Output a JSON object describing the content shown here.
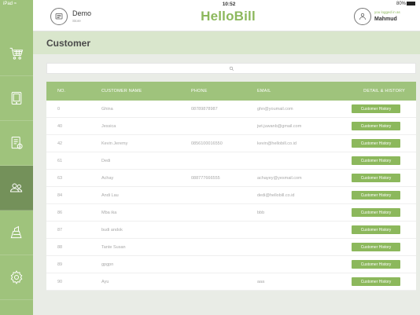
{
  "status_bar": {
    "device": "iPad",
    "time": "10:52",
    "battery": "80%"
  },
  "header": {
    "store_name": "Demo",
    "store_sub": "Store",
    "brand": "HelloBill",
    "logged_in_label": "you logged in as",
    "user_name": "Mahmud"
  },
  "sidebar": {
    "items": [
      {
        "icon": "cart-icon"
      },
      {
        "icon": "tablet-icon"
      },
      {
        "icon": "receipt-icon"
      },
      {
        "icon": "customers-icon",
        "active": true
      },
      {
        "icon": "delivery-icon"
      },
      {
        "icon": "settings-icon"
      }
    ]
  },
  "page": {
    "title": "Customer"
  },
  "search": {
    "placeholder": ""
  },
  "table": {
    "headers": {
      "no": "NO.",
      "name": "CUSTOMER NAME",
      "phone": "PHONE",
      "email": "EMAIL",
      "history": "DETAIL & HISTORY"
    },
    "history_label": "Customer History",
    "rows": [
      {
        "no": "0",
        "name": "Ghina",
        "phone": "08789878987",
        "email": "ghn@youmail.com"
      },
      {
        "no": "40",
        "name": "Jessica",
        "phone": "",
        "email": "jwt.juwanb@gmail.com"
      },
      {
        "no": "42",
        "name": "Kevin Jeremy",
        "phone": "0856100016550",
        "email": "kevin@hellobill.co.id"
      },
      {
        "no": "61",
        "name": "Dedi",
        "phone": "",
        "email": ""
      },
      {
        "no": "63",
        "name": "Achay",
        "phone": "088777666555",
        "email": "achayey@yesmail.com"
      },
      {
        "no": "84",
        "name": "Andi Lau",
        "phone": "",
        "email": "dedi@hellobill.co.id"
      },
      {
        "no": "86",
        "name": "Mba ika",
        "phone": "",
        "email": "bbb"
      },
      {
        "no": "87",
        "name": "budi andok",
        "phone": "",
        "email": ""
      },
      {
        "no": "88",
        "name": "Tante Susan",
        "phone": "",
        "email": ""
      },
      {
        "no": "89",
        "name": "gpgpn",
        "phone": "",
        "email": ""
      },
      {
        "no": "90",
        "name": "Ayu",
        "phone": "",
        "email": "aaa"
      }
    ]
  },
  "colors": {
    "brand": "#8cb85c",
    "sidebar": "#9fc37c",
    "sidebar_active": "#74915a",
    "title_bar": "#d9e6cc"
  }
}
